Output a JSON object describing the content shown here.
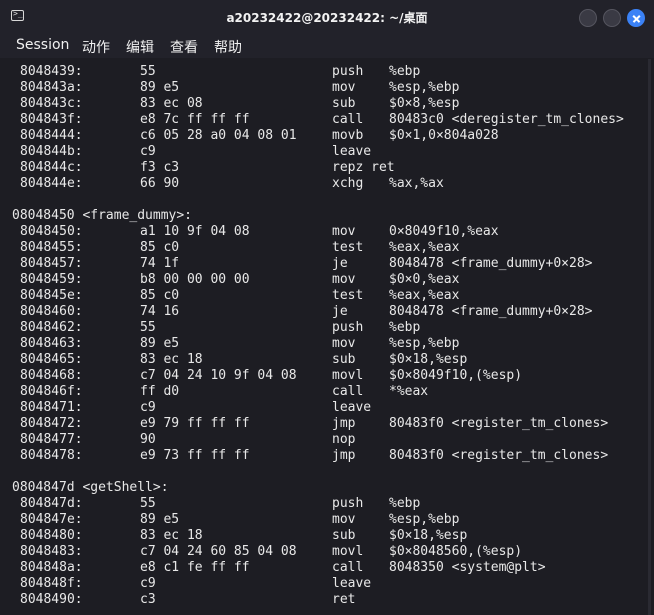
{
  "window": {
    "title": "a20232422@20232422: ~/桌面",
    "icon": "terminal-icon",
    "buttons": [
      "minimize",
      "maximize",
      "close"
    ],
    "accent": "#3b82f6"
  },
  "menu": [
    "Session",
    "动作",
    "编辑",
    "查看",
    "帮助"
  ],
  "lines": [
    {
      "type": "ins",
      "addr": "8048439:",
      "bytes": "55",
      "op": "push",
      "args": "%ebp"
    },
    {
      "type": "ins",
      "addr": "804843a:",
      "bytes": "89 e5",
      "op": "mov",
      "args": "%esp,%ebp"
    },
    {
      "type": "ins",
      "addr": "804843c:",
      "bytes": "83 ec 08",
      "op": "sub",
      "args": "$0×8,%esp"
    },
    {
      "type": "ins",
      "addr": "804843f:",
      "bytes": "e8 7c ff ff ff",
      "op": "call",
      "args": "80483c0 <deregister_tm_clones>"
    },
    {
      "type": "ins",
      "addr": "8048444:",
      "bytes": "c6 05 28 a0 04 08 01",
      "op": "movb",
      "args": "$0×1,0×804a028"
    },
    {
      "type": "ins",
      "addr": "804844b:",
      "bytes": "c9",
      "op": "leave",
      "args": ""
    },
    {
      "type": "ins",
      "addr": "804844c:",
      "bytes": "f3 c3",
      "op": "repz ret",
      "args": ""
    },
    {
      "type": "ins",
      "addr": "804844e:",
      "bytes": "66 90",
      "op": "xchg",
      "args": "%ax,%ax"
    },
    {
      "type": "blank"
    },
    {
      "type": "label",
      "text": "08048450 <frame_dummy>:"
    },
    {
      "type": "ins",
      "addr": "8048450:",
      "bytes": "a1 10 9f 04 08",
      "op": "mov",
      "args": "0×8049f10,%eax"
    },
    {
      "type": "ins",
      "addr": "8048455:",
      "bytes": "85 c0",
      "op": "test",
      "args": "%eax,%eax"
    },
    {
      "type": "ins",
      "addr": "8048457:",
      "bytes": "74 1f",
      "op": "je",
      "args": "8048478 <frame_dummy+0×28>"
    },
    {
      "type": "ins",
      "addr": "8048459:",
      "bytes": "b8 00 00 00 00",
      "op": "mov",
      "args": "$0×0,%eax"
    },
    {
      "type": "ins",
      "addr": "804845e:",
      "bytes": "85 c0",
      "op": "test",
      "args": "%eax,%eax"
    },
    {
      "type": "ins",
      "addr": "8048460:",
      "bytes": "74 16",
      "op": "je",
      "args": "8048478 <frame_dummy+0×28>"
    },
    {
      "type": "ins",
      "addr": "8048462:",
      "bytes": "55",
      "op": "push",
      "args": "%ebp"
    },
    {
      "type": "ins",
      "addr": "8048463:",
      "bytes": "89 e5",
      "op": "mov",
      "args": "%esp,%ebp"
    },
    {
      "type": "ins",
      "addr": "8048465:",
      "bytes": "83 ec 18",
      "op": "sub",
      "args": "$0×18,%esp"
    },
    {
      "type": "ins",
      "addr": "8048468:",
      "bytes": "c7 04 24 10 9f 04 08",
      "op": "movl",
      "args": "$0×8049f10,(%esp)"
    },
    {
      "type": "ins",
      "addr": "804846f:",
      "bytes": "ff d0",
      "op": "call",
      "args": "*%eax"
    },
    {
      "type": "ins",
      "addr": "8048471:",
      "bytes": "c9",
      "op": "leave",
      "args": ""
    },
    {
      "type": "ins",
      "addr": "8048472:",
      "bytes": "e9 79 ff ff ff",
      "op": "jmp",
      "args": "80483f0 <register_tm_clones>"
    },
    {
      "type": "ins",
      "addr": "8048477:",
      "bytes": "90",
      "op": "nop",
      "args": ""
    },
    {
      "type": "ins",
      "addr": "8048478:",
      "bytes": "e9 73 ff ff ff",
      "op": "jmp",
      "args": "80483f0 <register_tm_clones>"
    },
    {
      "type": "blank"
    },
    {
      "type": "label",
      "text": "0804847d <getShell>:"
    },
    {
      "type": "ins",
      "addr": "804847d:",
      "bytes": "55",
      "op": "push",
      "args": "%ebp"
    },
    {
      "type": "ins",
      "addr": "804847e:",
      "bytes": "89 e5",
      "op": "mov",
      "args": "%esp,%ebp"
    },
    {
      "type": "ins",
      "addr": "8048480:",
      "bytes": "83 ec 18",
      "op": "sub",
      "args": "$0×18,%esp"
    },
    {
      "type": "ins",
      "addr": "8048483:",
      "bytes": "c7 04 24 60 85 04 08",
      "op": "movl",
      "args": "$0×8048560,(%esp)"
    },
    {
      "type": "ins",
      "addr": "804848a:",
      "bytes": "e8 c1 fe ff ff",
      "op": "call",
      "args": "8048350 <system@plt>"
    },
    {
      "type": "ins",
      "addr": "804848f:",
      "bytes": "c9",
      "op": "leave",
      "args": ""
    },
    {
      "type": "ins",
      "addr": "8048490:",
      "bytes": "c3",
      "op": "ret",
      "args": ""
    }
  ]
}
